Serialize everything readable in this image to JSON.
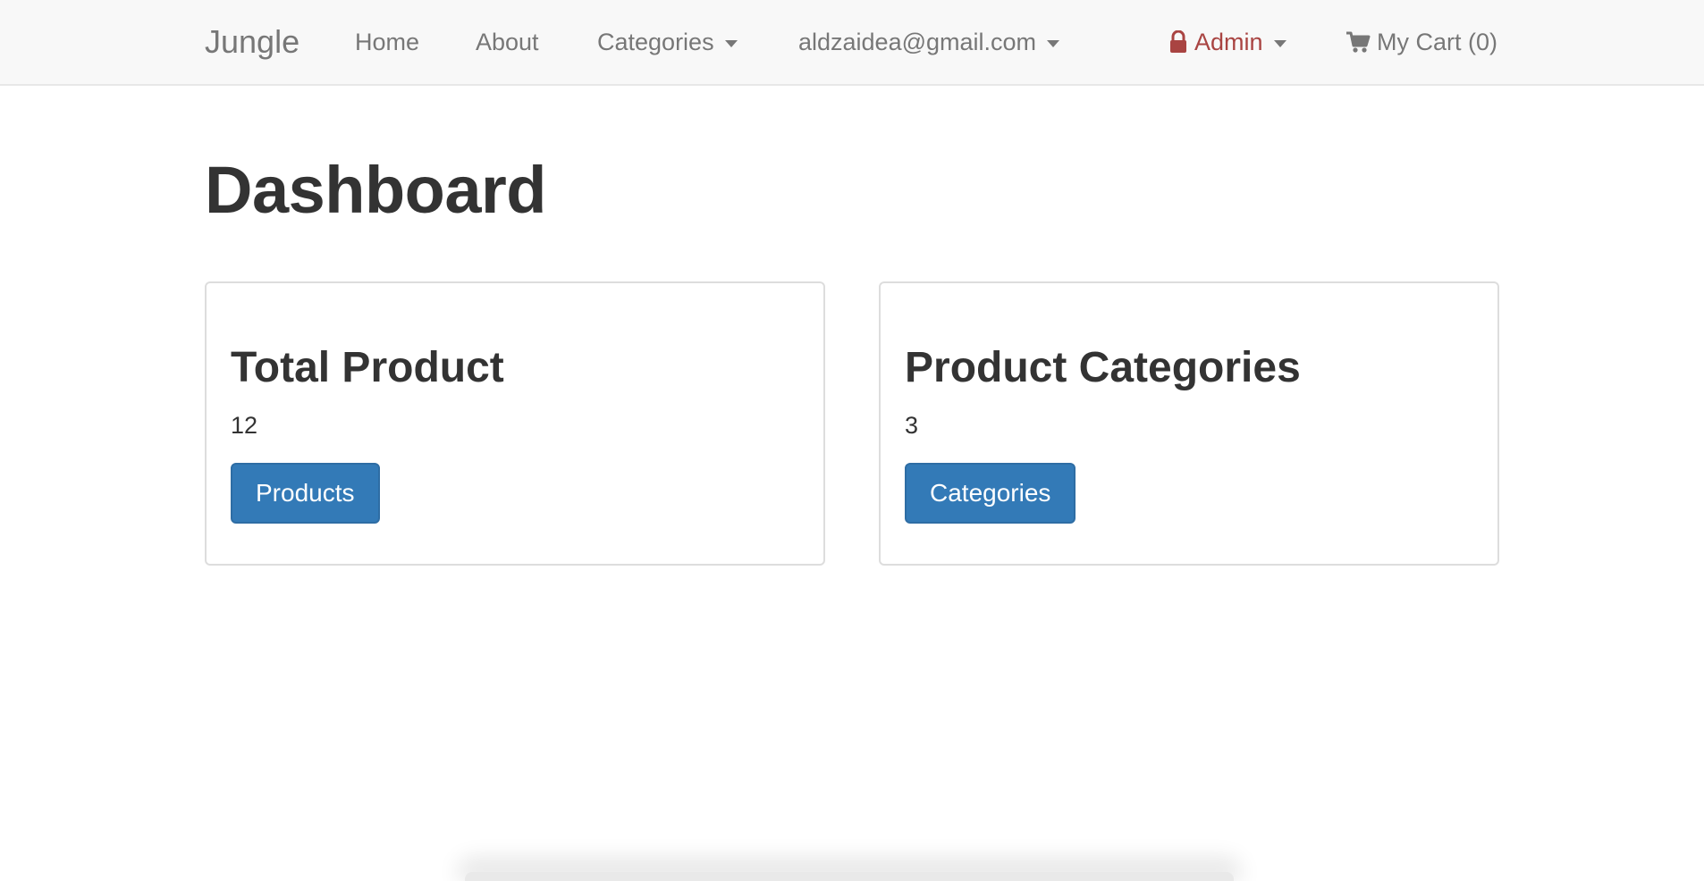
{
  "navbar": {
    "brand": "Jungle",
    "links": {
      "home": "Home",
      "about": "About",
      "categories": "Categories",
      "user_email": "aldzaidea@gmail.com",
      "admin": "Admin",
      "cart": "My Cart (0)"
    },
    "icons": {
      "admin": "lock-icon",
      "cart": "shopping-cart-icon"
    },
    "colors": {
      "admin": "#a94442",
      "link": "#777777"
    }
  },
  "main": {
    "title": "Dashboard",
    "panels": [
      {
        "title": "Total Product",
        "count": "12",
        "button_label": "Products"
      },
      {
        "title": "Product Categories",
        "count": "3",
        "button_label": "Categories"
      }
    ]
  },
  "colors": {
    "primary_button": "#337ab7"
  }
}
